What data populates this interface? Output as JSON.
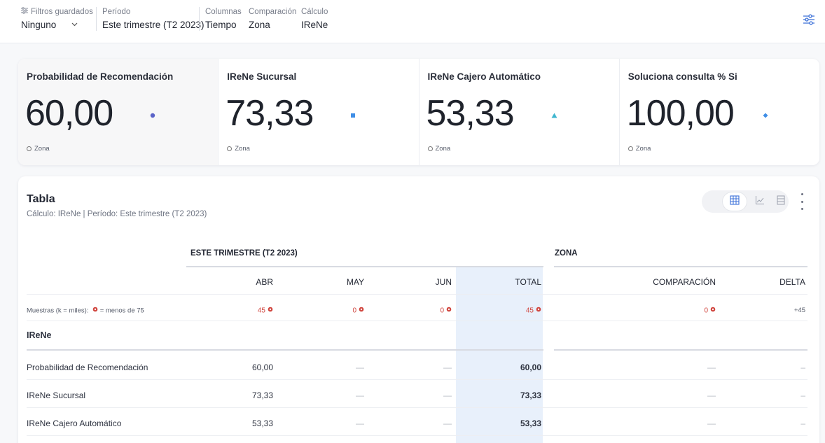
{
  "filters": {
    "saved": {
      "label": "Filtros guardados",
      "value": "Ninguno"
    },
    "period": {
      "label": "Período",
      "value": "Este trimestre (T2 2023)"
    },
    "columns": {
      "label": "Columnas",
      "value": "Tiempo"
    },
    "comparison": {
      "label": "Comparación",
      "value": "Zona"
    },
    "calc": {
      "label": "Cálculo",
      "value": "IReNe"
    }
  },
  "kpis": [
    {
      "title": "Probabilidad de Recomendación",
      "value": "60,00",
      "foot": "Zona",
      "mark": "circle",
      "color": "#5a63c8"
    },
    {
      "title": "IReNe Sucursal",
      "value": "73,33",
      "foot": "Zona",
      "mark": "square",
      "color": "#3f8ee6"
    },
    {
      "title": "IReNe Cajero Automático",
      "value": "53,33",
      "foot": "Zona",
      "mark": "triangle",
      "color": "#3fb6cf"
    },
    {
      "title": "Soluciona consulta % Si",
      "value": "100,00",
      "foot": "Zona",
      "mark": "diamond",
      "color": "#3f8ee6"
    }
  ],
  "table": {
    "title": "Tabla",
    "subtitle": "Cálculo: IReNe | Período: Este trimestre (T2 2023)",
    "group_period": "ESTE TRIMESTRE (T2 2023)",
    "group_zone": "ZONA",
    "columns": [
      "ABR",
      "MAY",
      "JUN",
      "TOTAL",
      "COMPARACIÓN",
      "DELTA"
    ],
    "samples": {
      "label_prefix": "Muestras (k = miles):",
      "label_suffix": "= menos de 75",
      "abr": "45",
      "may": "0",
      "jun": "0",
      "total": "45",
      "comparison": "0",
      "delta": "+45"
    },
    "section": "IReNe",
    "rows": [
      {
        "label": "Probabilidad de Recomendación",
        "abr": "60,00",
        "may": "—",
        "jun": "—",
        "total": "60,00",
        "comparison": "—",
        "delta": "–"
      },
      {
        "label": "IReNe Sucursal",
        "abr": "73,33",
        "may": "—",
        "jun": "—",
        "total": "73,33",
        "comparison": "—",
        "delta": "–"
      },
      {
        "label": "IReNe Cajero Automático",
        "abr": "53,33",
        "may": "—",
        "jun": "—",
        "total": "53,33",
        "comparison": "—",
        "delta": "–"
      }
    ]
  },
  "colors": {
    "accent": "#2f6fde",
    "highlight_column": "#e8f0fb",
    "below_threshold": "#d0443d"
  }
}
